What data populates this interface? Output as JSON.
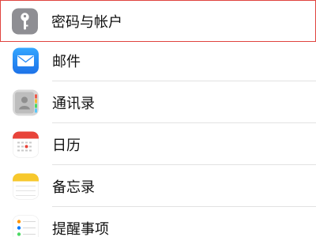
{
  "settings": {
    "items": [
      {
        "label": "密码与帐户",
        "icon": "key-icon",
        "selected": true
      },
      {
        "label": "邮件",
        "icon": "mail-icon",
        "selected": false
      },
      {
        "label": "通讯录",
        "icon": "contacts-icon",
        "selected": false
      },
      {
        "label": "日历",
        "icon": "calendar-icon",
        "selected": false
      },
      {
        "label": "备忘录",
        "icon": "notes-icon",
        "selected": false
      },
      {
        "label": "提醒事项",
        "icon": "reminders-icon",
        "selected": false
      }
    ]
  },
  "colors": {
    "selection_border": "#e0433f",
    "separator": "#e2e2e2",
    "mail_blue": "#2a8cf5",
    "calendar_red": "#e8443a",
    "notes_yellow": "#f7c82c",
    "key_gray": "#8e8e93"
  }
}
